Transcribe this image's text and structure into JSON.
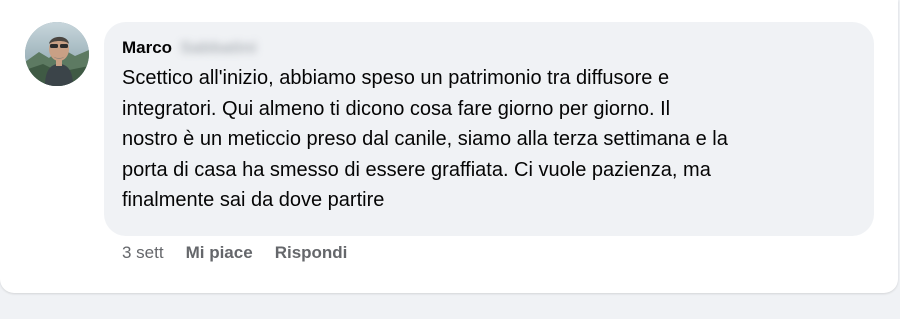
{
  "comment": {
    "author_first_name": "Marco",
    "author_last_name_blurred": "Sabbatini",
    "text": "Scettico all'inizio, abbiamo speso un patrimonio tra diffusore e\nintegratori. Qui almeno ti dicono cosa fare giorno per giorno. Il\nnostro è un meticcio preso dal canile, siamo alla terza settimana e la\nporta di casa ha smesso di essere graffiata. Ci vuole pazienza, ma\nfinalmente sai da dove partire",
    "timestamp": "3 sett",
    "like_label": "Mi piace",
    "reply_label": "Rispondi"
  },
  "colors": {
    "bubble_bg": "#f0f2f5",
    "text": "#050505",
    "secondary_text": "#65676b"
  }
}
